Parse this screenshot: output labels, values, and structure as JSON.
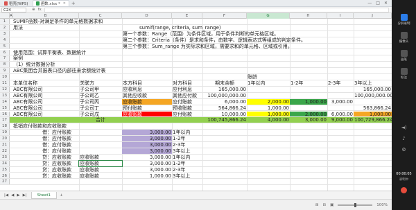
{
  "titlebar": {
    "tabs": [
      {
        "label": "稻壳(WPS)",
        "icon": "doc-red-icon",
        "active": false
      },
      {
        "label": "函数.xlsx *",
        "icon": "doc-green-icon",
        "active": true
      }
    ],
    "add_label": "+",
    "controls": [
      "—",
      "□",
      "✕"
    ]
  },
  "formula_bar": {
    "cell_ref": "C24",
    "icons": [
      "⊕",
      "fx"
    ],
    "value": ""
  },
  "columns": [
    "A",
    "B",
    "C",
    "D",
    "E",
    "F",
    "G",
    "H",
    "I",
    "J"
  ],
  "selected_column": "G",
  "row_numbers": [
    "1",
    "2",
    "3",
    "4",
    "5",
    "6",
    "7",
    "8",
    "9",
    "10",
    "11",
    "12",
    "13",
    "14",
    "15",
    "16",
    "17",
    "18",
    "19",
    "20",
    "21",
    "22",
    "23",
    "24",
    "25",
    "26",
    "27"
  ],
  "rows": {
    "r1": {
      "b": "SUMIF函数-对满足条件的单元格数据求和"
    },
    "r2": {
      "b": "用法",
      "d": "sumif(range, criteria, sum_range)"
    },
    "r3": {
      "d": "第一个参数：Range（范围）为条件区域，用于条件判断的单元格区域。"
    },
    "r4": {
      "d": "第二个参数：Criteria（条件）是求和条件，由数字、逻辑表达式等组成的判定条件。"
    },
    "r5": {
      "d": "第三个参数：Sum_range 为实际求和区域，需要求和的单元格、区域或引用。"
    },
    "r6": {
      "b": "使用范围：试算平衡表、数据统计"
    },
    "r7": {
      "b": "案例"
    },
    "r8": {
      "b": "（1）统计数据分析"
    },
    "r9": {
      "b": "ABC集团合并报表口径内部往来余额统计表"
    },
    "r10": {
      "g": "账龄"
    },
    "r11": {
      "b": "本单位名称",
      "c": "关联方",
      "d": "本方科目",
      "e": "对方科目",
      "f": "期末余额",
      "g": "1年以内",
      "h": "1-2年",
      "i": "2-3年",
      "j": "3年以上"
    },
    "r12": {
      "b": "ABC有限公司",
      "c": "子公司甲",
      "d": "应收利息",
      "e": "应付利息",
      "f": "165,000.00",
      "j": "165,000.00"
    },
    "r13": {
      "b": "ABC有限公司",
      "c": "子公司乙",
      "d": "其他应收款",
      "e": "其他应付款",
      "f": "100,000,000.00",
      "j": "100,000,000.00"
    },
    "r14": {
      "b": "ABC有限公司",
      "c": "子公司丙",
      "d": "应收账款",
      "e": "应付账款",
      "f": "6,000.00",
      "g": "2,000.00",
      "h": "1,000.00",
      "i": "3,000.00"
    },
    "r15": {
      "b": "ABC有限公司",
      "c": "子公司丁",
      "d": "预付账款",
      "e": "预收账款",
      "f": "564,866.24",
      "g": "1,000.00",
      "j": "563,866.24"
    },
    "r16": {
      "b": "ABC有限公司",
      "c": "子公司戊",
      "d": "应收账款",
      "e": "应付账款",
      "f": "10,000.00",
      "g": "1,000.00",
      "h": "2,000.00",
      "i": "6,000.00",
      "j": "1,000.00"
    },
    "r17": {
      "c": "合计",
      "f": "100,745,866.24",
      "g": "4,000.00",
      "h": "3,000.00",
      "i": "9,000.00",
      "j": "100,729,866.24"
    },
    "r18": {
      "b": "抵销应付账款和应收账款"
    },
    "r19": {
      "b": "借：应付账款",
      "d": "3,000.00",
      "e": "1年以内"
    },
    "r20": {
      "b": "借：应付账款",
      "d": "3,000.00",
      "e": "1-2年"
    },
    "r21": {
      "b": "借：应付账款",
      "d": "3,000.00",
      "e": "2-3年"
    },
    "r22": {
      "b": "借：应付账款",
      "d": "3,000.00",
      "e": "3年以上"
    },
    "r23": {
      "b": "贷：应收账款",
      "c": "应收账款",
      "d": "3,000.00",
      "e": "1年以内"
    },
    "r24": {
      "b": "贷：应收账款",
      "c": "应收账款",
      "d": "3,000.00",
      "e": "1-2年"
    },
    "r25": {
      "b": "贷：应收账款",
      "c": "应收账款",
      "d": "3,000.00",
      "e": "2-3年"
    },
    "r26": {
      "b": "贷：应收账款",
      "c": "应收账款",
      "d": "1,000.00",
      "e": "3年以上"
    },
    "r27": {}
  },
  "fill_colors": {
    "orange": "#f5a623",
    "yellow": "#ffff00",
    "green": "#3aa64a",
    "lightgreen": "#92d050",
    "purple": "#b4a7d6",
    "red": "#ff0000"
  },
  "sheetbar": {
    "nav": [
      "|◀",
      "◀",
      "▶",
      "▶|"
    ],
    "sheet_name": "Sheet1",
    "add_label": "+"
  },
  "statusbar": {
    "left": "",
    "zoom": "100%",
    "icons": [
      "⊞",
      "⊟",
      "▣"
    ]
  },
  "side_panel": {
    "buttons": [
      "分屏录制",
      "摄像头",
      "画笔",
      "标注"
    ],
    "time_label": "00:00:05",
    "time_sub": "录制中"
  }
}
